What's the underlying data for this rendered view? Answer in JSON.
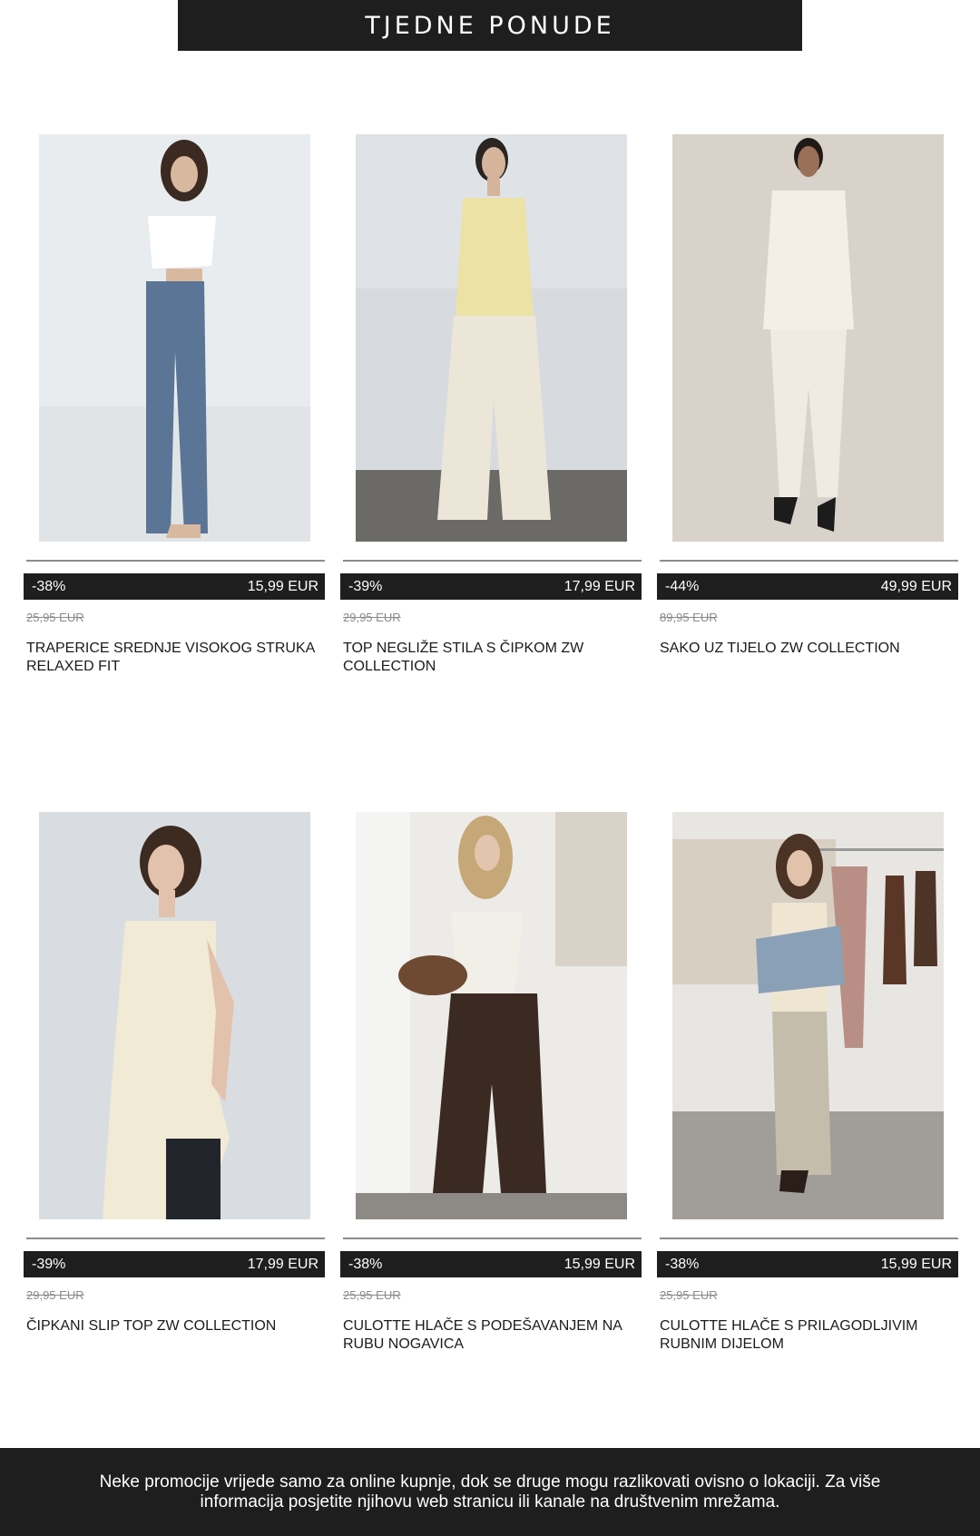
{
  "header": {
    "title": "TJEDNE PONUDE"
  },
  "products": [
    {
      "discount": "-38%",
      "price": "15,99 EUR",
      "old_price": "25,95 EUR",
      "name": "TRAPERICE SREDNJE VISOKOG STRUKA RELAXED FIT",
      "image_desc": "model-wearing-blue-wide-jeans-and-white-crop-top"
    },
    {
      "discount": "-39%",
      "price": "17,99 EUR",
      "old_price": "29,95 EUR",
      "name": "TOP NEGLIŽE STILA S ČIPKOM ZW COLLECTION",
      "image_desc": "model-wearing-yellow-lace-camisole-and-cream-trousers"
    },
    {
      "discount": "-44%",
      "price": "49,99 EUR",
      "old_price": "89,95 EUR",
      "name": "SAKO UZ TIJELO ZW COLLECTION",
      "image_desc": "model-wearing-white-fitted-blazer-and-trousers"
    },
    {
      "discount": "-39%",
      "price": "17,99 EUR",
      "old_price": "29,95 EUR",
      "name": "ČIPKANI SLIP TOP ZW COLLECTION",
      "image_desc": "model-wearing-cream-lace-slip-top"
    },
    {
      "discount": "-38%",
      "price": "15,99 EUR",
      "old_price": "25,95 EUR",
      "name": "CULOTTE HLAČE S PODEŠAVANJEM NA RUBU NOGAVICA",
      "image_desc": "model-wearing-brown-culottes-and-white-top"
    },
    {
      "discount": "-38%",
      "price": "15,99 EUR",
      "old_price": "25,95 EUR",
      "name": "CULOTTE HLAČE S PRILAGODLJIVIM RUBNIM DIJELOM",
      "image_desc": "model-wearing-beige-culottes-with-denim-jacket"
    }
  ],
  "footer": {
    "text": "Neke promocije vrijede samo za online kupnje, dok se druge mogu razlikovati ovisno o lokaciji. Za više informacija posjetite njihovu web stranicu ili kanale na društvenim mrežama."
  },
  "colors": {
    "bar_background": "#1e1e1e",
    "bar_text": "#ffffff",
    "old_price": "#8a8a8a",
    "divider": "#8c8c8c"
  }
}
